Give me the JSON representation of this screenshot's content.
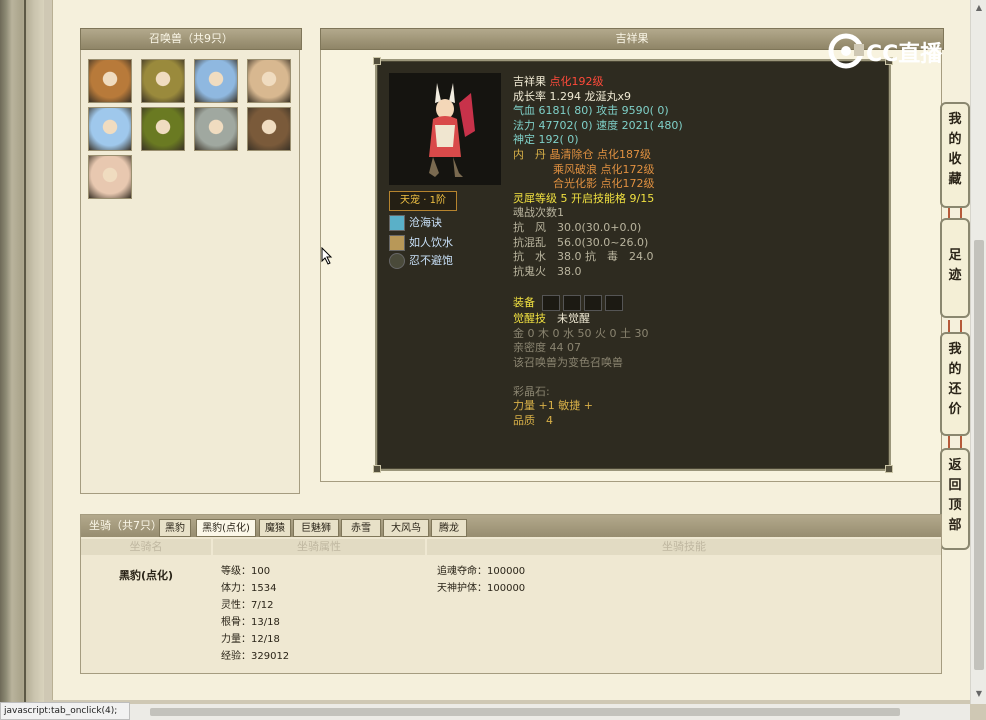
{
  "statusbar": {
    "text": "javascript:tab_onclick(4);"
  },
  "watermark": {
    "text": "CC直播"
  },
  "summon": {
    "title": "召唤兽（共9只）",
    "avatars": [
      {
        "name": "avatar-1",
        "color": "#b87a3a"
      },
      {
        "name": "avatar-2",
        "color": "#9a8a3c"
      },
      {
        "name": "avatar-3",
        "color": "#8fb8e0"
      },
      {
        "name": "avatar-4",
        "color": "#d8b890"
      },
      {
        "name": "avatar-5",
        "color": "#9fc8ec"
      },
      {
        "name": "avatar-6",
        "color": "#6a7a22"
      },
      {
        "name": "avatar-7",
        "color": "#a0a8a0"
      },
      {
        "name": "avatar-8",
        "color": "#7a5a3a"
      },
      {
        "name": "avatar-9",
        "color": "#e8c8b0"
      }
    ]
  },
  "detail": {
    "title": "吉祥果",
    "tianchong": "天宠 · 1阶",
    "skills": [
      "沧海诀",
      "如人饮水",
      "忍不避饱"
    ],
    "name": "吉祥果",
    "dianhua": "点化192级",
    "growth_label": "成长率",
    "growth_value": "1.294",
    "longjing": "龙涎丸x9",
    "qixue_label": "气血",
    "qixue": "6181( 80)",
    "gongji_label": "攻击",
    "gongji": "9590( 0)",
    "fali_label": "法力",
    "fali": "47702( 0)",
    "sudu_label": "速度",
    "sudu": "2021( 480)",
    "shending_label": "神定",
    "shending": "192( 0)",
    "neidan_label": "内　丹",
    "neidan": [
      "晶清除仓 点化187级",
      "乘风破浪 点化172级",
      "合光化影 点化172级"
    ],
    "lingxi_label": "灵犀等级",
    "lingxi_value": "5",
    "kaiqi_label": "开启技能格",
    "kaiqi_value": "9/15",
    "hunyu_label": "魂战次数",
    "hunyu_value": "1",
    "kang_feng": "抗　风　30.0(30.0+0.0)",
    "kang_hun": "抗混乱　56.0(30.0~26.0)",
    "kang_shui_du": "抗　水　38.0 抗　毒　24.0",
    "kang_gui": "抗鬼火　38.0",
    "equip_label": "装备",
    "juexing_label": "觉醒技",
    "juexing_value": "未觉醒",
    "wuxing": "金 0 木 0 水 50 火 0 土 30",
    "qinmi": "亲密度 44 07",
    "note": "该召唤兽为变色召唤兽",
    "caijing_label": "彩晶石:",
    "liliang": "力量 +1 敏捷 +",
    "pinzhi": "品质　4"
  },
  "side_tabs": [
    {
      "id": "favorites",
      "chars": [
        "我",
        "的",
        "收",
        "藏"
      ]
    },
    {
      "id": "footprint",
      "chars": [
        "足",
        "迹"
      ]
    },
    {
      "id": "bargain",
      "chars": [
        "我",
        "的",
        "还",
        "价"
      ]
    },
    {
      "id": "top",
      "chars": [
        "返",
        "回",
        "顶",
        "部"
      ]
    }
  ],
  "mounts": {
    "title": "坐骑（共7只）",
    "tabs": [
      "黑豹",
      "黑豹(点化)",
      "魔猿",
      "巨魅狮",
      "赤雪",
      "大风鸟",
      "腾龙"
    ],
    "active_tab": 1,
    "col_name": "坐骑名",
    "col_attr": "坐骑属性",
    "col_skill": "坐骑技能",
    "name": "黑豹(点化)",
    "attrs": [
      "等级：100",
      "体力：1534",
      "灵性：7/12",
      "根骨：13/18",
      "力量：12/18",
      "经验：329012"
    ],
    "skills": [
      "追魂夺命：100000",
      "天神护体：100000"
    ]
  }
}
